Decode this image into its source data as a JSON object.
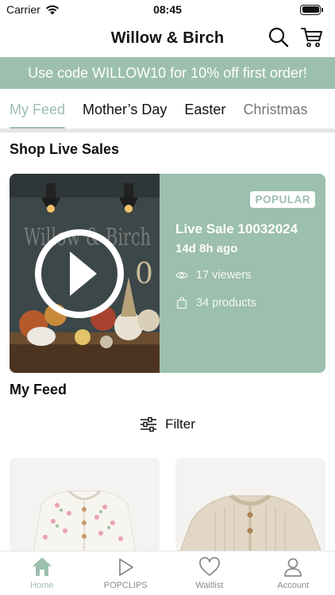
{
  "status": {
    "carrier": "Carrier",
    "time": "08:45"
  },
  "header": {
    "title": "Willow & Birch",
    "search_icon": "search-icon",
    "cart_icon": "cart-icon"
  },
  "promo": {
    "text": "Use code WILLOW10 for 10% off first order!"
  },
  "tabs": [
    {
      "label": "My Feed",
      "active": true
    },
    {
      "label": "Mother’s Day"
    },
    {
      "label": "Easter"
    },
    {
      "label": "Christmas"
    }
  ],
  "sections": {
    "live_sales": "Shop Live Sales",
    "my_feed": "My Feed"
  },
  "live_sale": {
    "badge": "POPULAR",
    "title": "Live Sale 10032024",
    "time_ago": "14d 8h ago",
    "viewers": "17 viewers",
    "products": "34 products",
    "thumb_sign": "Willow & Birch"
  },
  "filter": {
    "label": "Filter"
  },
  "bottom_nav": [
    {
      "label": "Home",
      "icon": "home-icon",
      "active": true
    },
    {
      "label": "POPCLIPS",
      "icon": "play-icon"
    },
    {
      "label": "Waitlist",
      "icon": "heart-icon"
    },
    {
      "label": "Account",
      "icon": "user-icon"
    }
  ],
  "colors": {
    "accent": "#9cbfae",
    "text": "#111111",
    "muted": "#8a8a8a"
  }
}
